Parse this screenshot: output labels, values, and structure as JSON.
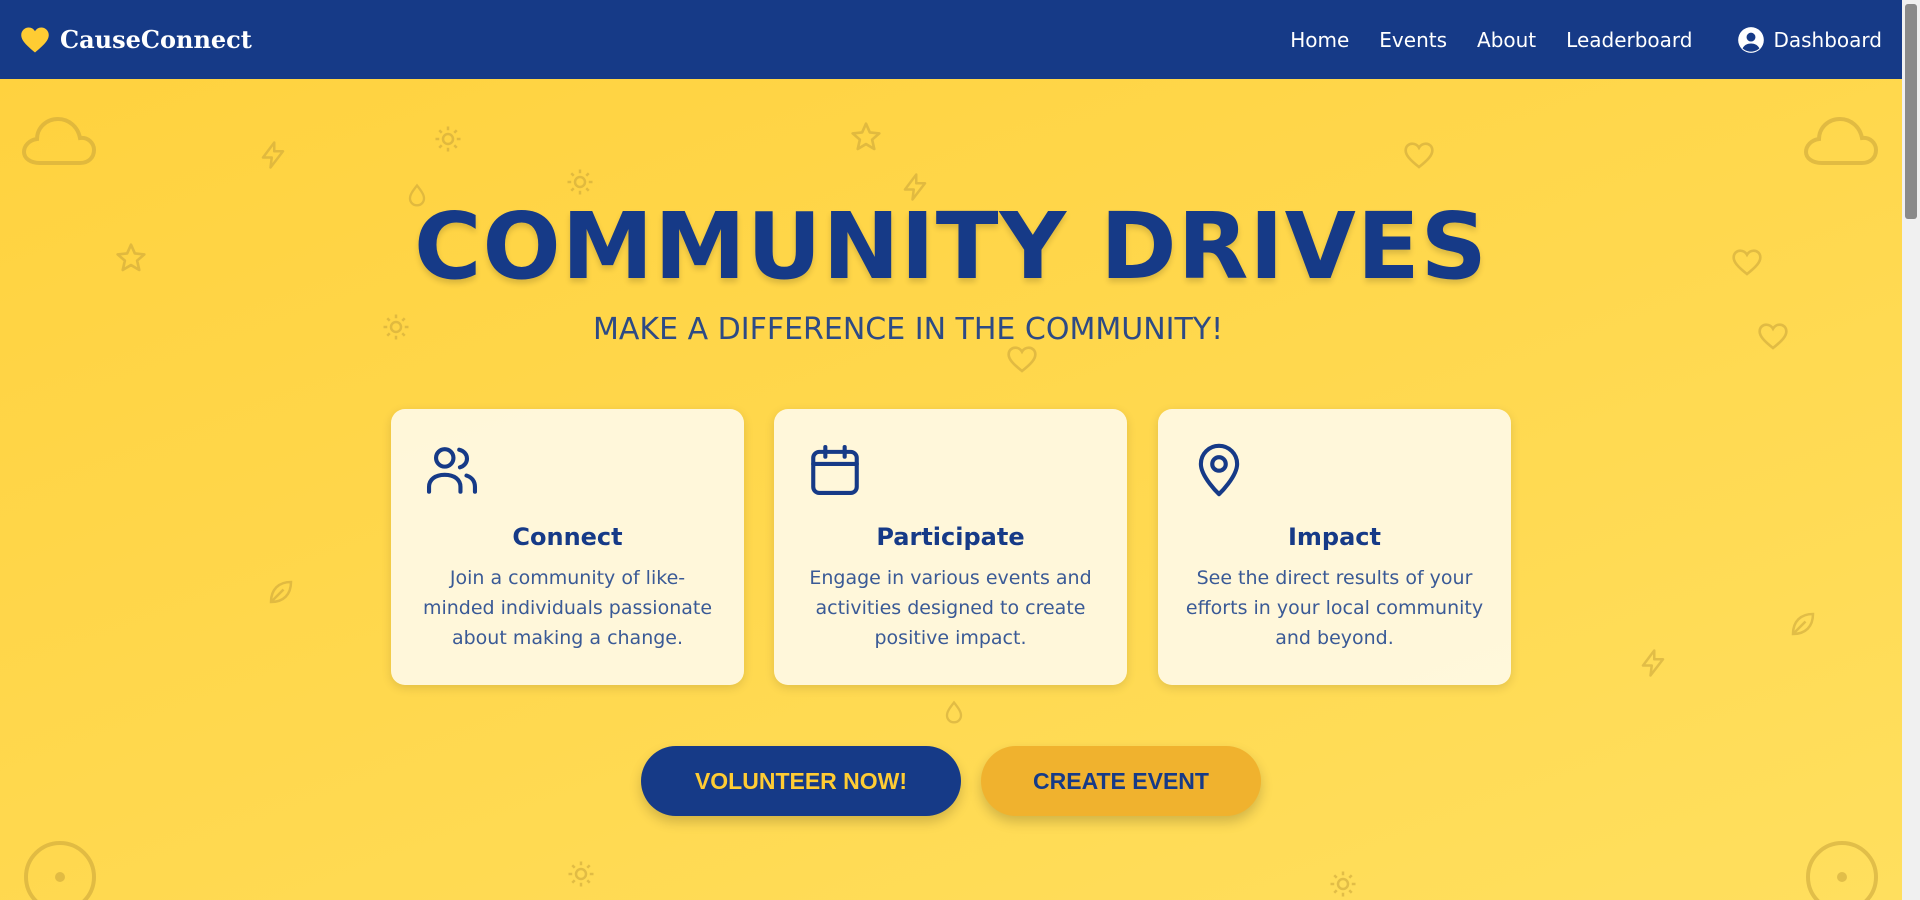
{
  "brand": {
    "name": "CauseConnect",
    "icon": "heart-icon"
  },
  "nav": {
    "links": [
      "Home",
      "Events",
      "About",
      "Leaderboard"
    ],
    "dashboard_label": "Dashboard",
    "dashboard_icon": "user-circle-icon"
  },
  "hero": {
    "title": "COMMUNITY DRIVES",
    "subtitle": "MAKE A DIFFERENCE IN THE COMMUNITY!"
  },
  "cards": [
    {
      "icon": "users-icon",
      "title": "Connect",
      "text": "Join a community of like-minded individuals passionate about making a change."
    },
    {
      "icon": "calendar-icon",
      "title": "Participate",
      "text": "Engage in various events and activities designed to create positive impact."
    },
    {
      "icon": "map-pin-icon",
      "title": "Impact",
      "text": "See the direct results of your efforts in your local community and beyond."
    }
  ],
  "buttons": {
    "primary_label": "VOLUNTEER NOW!",
    "secondary_label": "CREATE EVENT"
  },
  "colors": {
    "navy": "#163a87",
    "yellow": "#ffd54f",
    "accent_gold": "#f0b22e",
    "brand_heart": "#ffcc33"
  }
}
